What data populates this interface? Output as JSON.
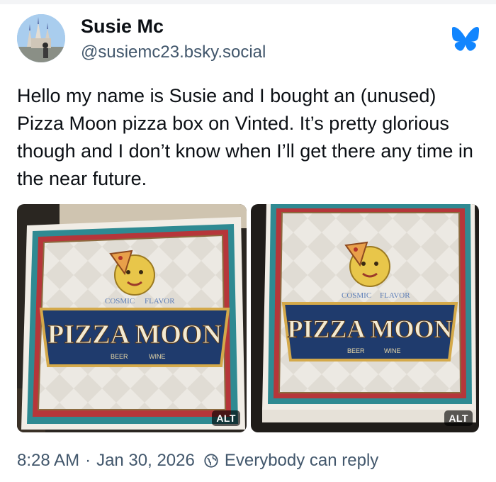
{
  "author": {
    "display_name": "Susie Mc",
    "handle": "@susiemc23.bsky.social",
    "avatar_icon": "castle-photo-avatar"
  },
  "brand": {
    "logo_icon": "butterfly-icon",
    "color": "#1185fe"
  },
  "post": {
    "text": "Hello my name is Susie and I bought an (unused) Pizza Moon pizza box on Vinted. It’s pretty glorious though and I don’t know when I’ll get there any time in the near future."
  },
  "images": [
    {
      "alt_badge": "ALT",
      "box_brand": "PIZZA MOON",
      "box_top_left": "COSMIC",
      "box_top_right": "FLAVOR",
      "box_bottom_left": "BEER",
      "box_bottom_right": "WINE"
    },
    {
      "alt_badge": "ALT",
      "box_brand": "PIZZA MOON",
      "box_top_left": "COSMIC",
      "box_top_right": "FLAVOR",
      "box_bottom_left": "BEER",
      "box_bottom_right": "WINE"
    }
  ],
  "meta": {
    "time": "8:28 AM",
    "separator": "·",
    "date": "Jan 30, 2026",
    "reply_setting": "Everybody can reply",
    "reply_icon": "globe-icon"
  },
  "colors": {
    "text": "#0b0f14",
    "muted": "#42576c"
  }
}
